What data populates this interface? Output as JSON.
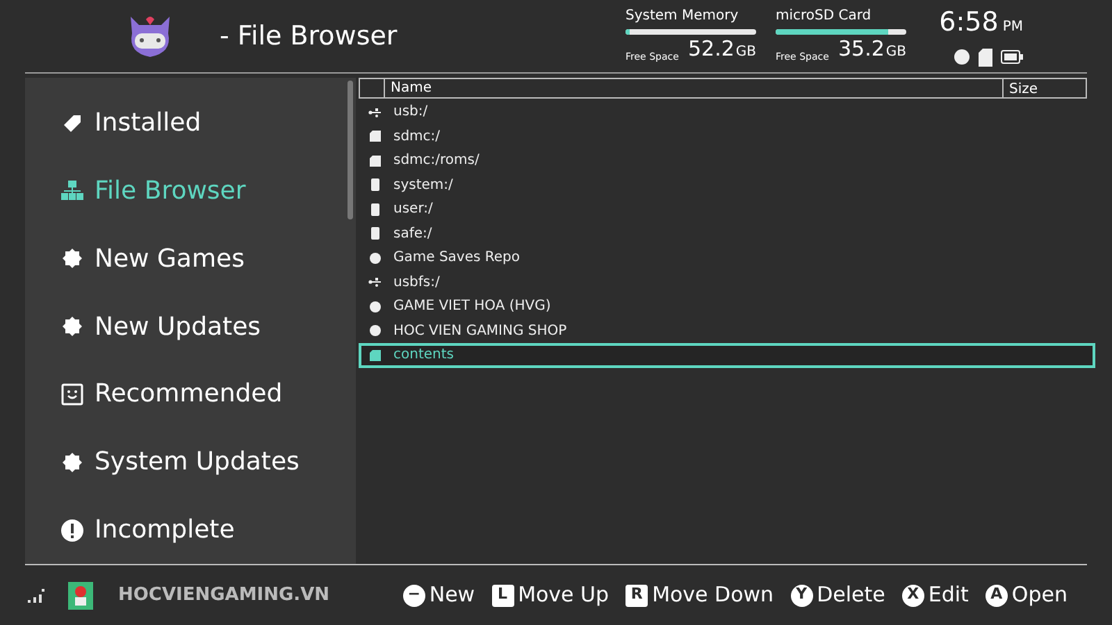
{
  "header": {
    "title": "- File Browser"
  },
  "storage": [
    {
      "label": "System Memory",
      "free_label": "Free Space",
      "amount": "52.2",
      "unit": "GB",
      "level": 0.03
    },
    {
      "label": "microSD Card",
      "free_label": "Free Space",
      "amount": "35.2",
      "unit": "GB",
      "level": 0.86
    }
  ],
  "clock": {
    "time": "6:58",
    "ampm": "PM"
  },
  "sidebar": {
    "items": [
      {
        "label": "Installed",
        "kind": "tag",
        "selected": false
      },
      {
        "label": "File Browser",
        "kind": "tree",
        "selected": true
      },
      {
        "label": "New Games",
        "kind": "badge",
        "selected": false
      },
      {
        "label": "New Updates",
        "kind": "badge",
        "selected": false
      },
      {
        "label": "Recommended",
        "kind": "smile",
        "selected": false
      },
      {
        "label": "System Updates",
        "kind": "badge",
        "selected": false
      },
      {
        "label": "Incomplete",
        "kind": "alert",
        "selected": false
      }
    ]
  },
  "table": {
    "columns": [
      "Name",
      "Size"
    ],
    "rows": [
      {
        "name": "usb:/",
        "kind": "usb",
        "selected": false
      },
      {
        "name": "sdmc:/",
        "kind": "sd",
        "selected": false
      },
      {
        "name": "sdmc:/roms/",
        "kind": "sd",
        "selected": false
      },
      {
        "name": "system:/",
        "kind": "drive",
        "selected": false
      },
      {
        "name": "user:/",
        "kind": "drive",
        "selected": false
      },
      {
        "name": "safe:/",
        "kind": "drive",
        "selected": false
      },
      {
        "name": "Game Saves Repo",
        "kind": "dot",
        "selected": false
      },
      {
        "name": "usbfs:/",
        "kind": "usb",
        "selected": false
      },
      {
        "name": "GAME VIET HOA (HVG)",
        "kind": "dot",
        "selected": false
      },
      {
        "name": "HOC VIEN GAMING SHOP",
        "kind": "dot",
        "selected": false
      },
      {
        "name": "contents",
        "kind": "sd",
        "selected": true
      }
    ]
  },
  "footer": {
    "brand": "HOCVIENGAMING.VN",
    "hints": [
      {
        "key": "−",
        "kind": "round",
        "label": "New"
      },
      {
        "key": "L",
        "kind": "square",
        "label": "Move Up"
      },
      {
        "key": "R",
        "kind": "square",
        "label": "Move Down"
      },
      {
        "key": "Y",
        "kind": "round",
        "label": "Delete"
      },
      {
        "key": "X",
        "kind": "round",
        "label": "Edit"
      },
      {
        "key": "A",
        "kind": "round",
        "label": "Open"
      }
    ]
  }
}
